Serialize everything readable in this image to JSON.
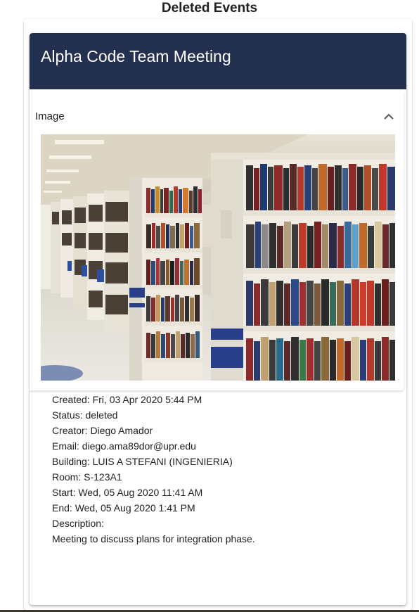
{
  "page": {
    "title": "Deleted Events"
  },
  "event": {
    "title": "Alpha Code Team Meeting",
    "image_panel": {
      "label": "Image",
      "expanded": true,
      "image_subject": "library bookshelves"
    },
    "details": [
      "Created: Fri, 03 Apr 2020 5:44 PM",
      "Status: deleted",
      "Creator: Diego Amador",
      "Email: diego.ama89dor@upr.edu",
      "Building: LUIS A STEFANI (INGENIERIA)",
      "Room: S-123A1",
      "Start: Wed, 05 Aug 2020 11:41 AM",
      "End: Wed, 05 Aug 2020 1:41 PM",
      "Description:",
      "Meeting to discuss plans for integration phase."
    ]
  },
  "colors": {
    "header_bg": "#243050",
    "header_text": "#ffffff",
    "text": "#212121"
  }
}
